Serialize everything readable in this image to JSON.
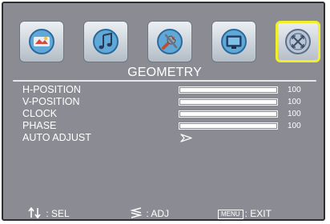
{
  "tabs": [
    {
      "icon": "picture-settings-icon",
      "active": false
    },
    {
      "icon": "audio-icon",
      "active": false
    },
    {
      "icon": "tools-icon",
      "active": false
    },
    {
      "icon": "display-icon",
      "active": false
    },
    {
      "icon": "geometry-icon",
      "active": true
    }
  ],
  "panel": {
    "title": "GEOMETRY",
    "items": [
      {
        "label": "H-POSITION",
        "value": "100",
        "level": 1.0
      },
      {
        "label": "V-POSITION",
        "value": "100",
        "level": 1.0
      },
      {
        "label": "CLOCK",
        "value": "100",
        "level": 1.0
      },
      {
        "label": "PHASE",
        "value": "100",
        "level": 1.0
      }
    ],
    "auto_adjust": {
      "label": "AUTO ADJUST",
      "icon": "arrow-right-icon"
    }
  },
  "footer": {
    "select": {
      "icon": "up-down-arrow-icon",
      "text": ": SEL"
    },
    "adjust": {
      "icon": "left-right-arrow-icon",
      "text": ": ADJ"
    },
    "exit": {
      "key": "MENU",
      "text": ": EXIT"
    }
  },
  "colors": {
    "background": "#8b8c93",
    "highlight": "#f1ee2a",
    "text": "#ffffff"
  }
}
